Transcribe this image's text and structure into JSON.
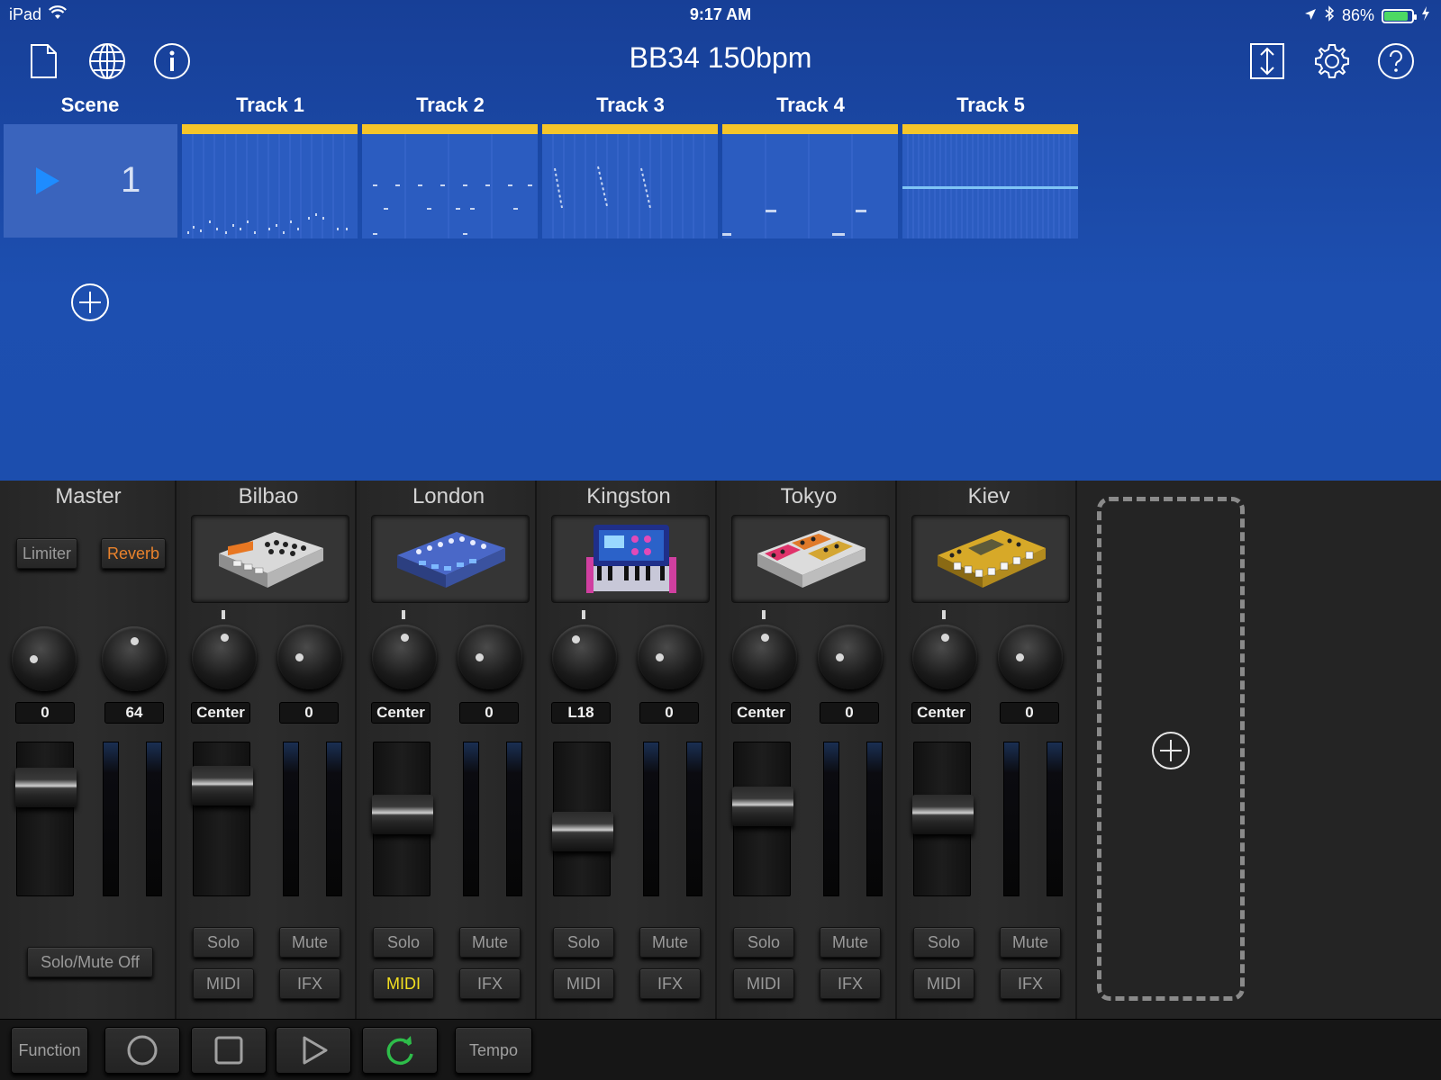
{
  "status_bar": {
    "device": "iPad",
    "time": "9:17 AM",
    "battery_percent": "86%",
    "battery_level": 0.86
  },
  "header": {
    "title": "BB34 150bpm",
    "icons": [
      "document-icon",
      "globe-icon",
      "info-icon",
      "resize-icon",
      "gear-icon",
      "help-icon"
    ]
  },
  "scene_grid": {
    "scene_header": "Scene",
    "track_headers": [
      "Track 1",
      "Track 2",
      "Track 3",
      "Track 4",
      "Track 5"
    ],
    "scenes": [
      {
        "number": "1"
      }
    ],
    "clip_color": "#f5c52a"
  },
  "mixer": {
    "master": {
      "name": "Master",
      "limiter_label": "Limiter",
      "reverb_label": "Reverb",
      "knob1_value": "0",
      "knob2_value": "64",
      "solo_mute_off_label": "Solo/Mute Off",
      "fader_level": 0.78
    },
    "tracks": [
      {
        "name": "Bilbao",
        "pan": "Center",
        "send": "0",
        "solo": "Solo",
        "mute": "Mute",
        "midi": "MIDI",
        "ifx": "IFX",
        "fader_level": 0.8,
        "midi_active": false
      },
      {
        "name": "London",
        "pan": "Center",
        "send": "0",
        "solo": "Solo",
        "mute": "Mute",
        "midi": "MIDI",
        "ifx": "IFX",
        "fader_level": 0.55,
        "midi_active": true
      },
      {
        "name": "Kingston",
        "pan": "L18",
        "send": "0",
        "solo": "Solo",
        "mute": "Mute",
        "midi": "MIDI",
        "ifx": "IFX",
        "fader_level": 0.4,
        "midi_active": false
      },
      {
        "name": "Tokyo",
        "pan": "Center",
        "send": "0",
        "solo": "Solo",
        "mute": "Mute",
        "midi": "MIDI",
        "ifx": "IFX",
        "fader_level": 0.62,
        "midi_active": false
      },
      {
        "name": "Kiev",
        "pan": "Center",
        "send": "0",
        "solo": "Solo",
        "mute": "Mute",
        "midi": "MIDI",
        "ifx": "IFX",
        "fader_level": 0.55,
        "midi_active": false
      }
    ]
  },
  "transport": {
    "function_label": "Function",
    "tempo_label": "Tempo",
    "loop_color": "#2ebd4a"
  }
}
